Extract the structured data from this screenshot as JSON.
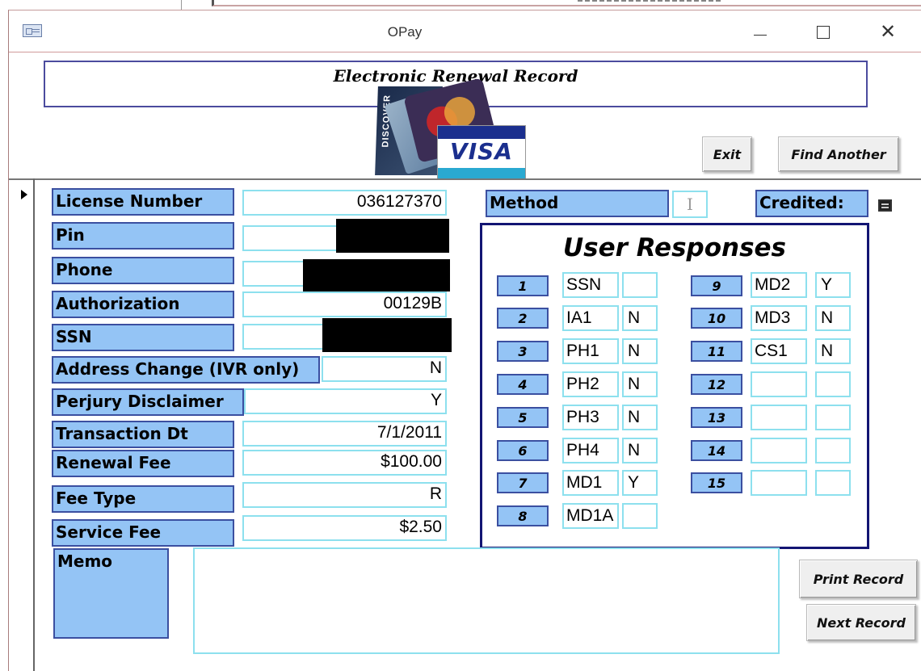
{
  "window": {
    "title": "OPay"
  },
  "header": {
    "title": "Electronic Renewal Record"
  },
  "cards": {
    "discover": "DISCOVER",
    "visa": "VISA"
  },
  "buttons": {
    "exit": "Exit",
    "find_another": "Find Another",
    "print_record": "Print Record",
    "next_record": "Next Record"
  },
  "fields": [
    {
      "label": "License Number",
      "value": "036127370",
      "redacted": false
    },
    {
      "label": "Pin",
      "value": "",
      "redacted": true
    },
    {
      "label": "Phone",
      "value": "",
      "redacted": true
    },
    {
      "label": "Authorization",
      "value": "00129B",
      "redacted": false
    },
    {
      "label": "SSN",
      "value": "",
      "redacted": true
    },
    {
      "label": "Address Change (IVR only)",
      "value": "N",
      "redacted": false
    },
    {
      "label": "Perjury Disclaimer",
      "value": "Y",
      "redacted": false
    },
    {
      "label": "Transaction Dt",
      "value": "7/1/2011",
      "redacted": false
    },
    {
      "label": "Renewal Fee",
      "value": "$100.00",
      "redacted": false
    },
    {
      "label": "Fee Type",
      "value": "R",
      "redacted": false
    },
    {
      "label": "Service Fee",
      "value": "$2.50",
      "redacted": false
    }
  ],
  "method": {
    "label": "Method",
    "value": "I"
  },
  "credited": {
    "label": "Credited:"
  },
  "user_responses": {
    "title": "User Responses",
    "items": [
      {
        "num": "1",
        "code": "SSN",
        "answer": ""
      },
      {
        "num": "2",
        "code": "IA1",
        "answer": "N"
      },
      {
        "num": "3",
        "code": "PH1",
        "answer": "N"
      },
      {
        "num": "4",
        "code": "PH2",
        "answer": "N"
      },
      {
        "num": "5",
        "code": "PH3",
        "answer": "N"
      },
      {
        "num": "6",
        "code": "PH4",
        "answer": "N"
      },
      {
        "num": "7",
        "code": "MD1",
        "answer": "Y"
      },
      {
        "num": "8",
        "code": "MD1A",
        "answer": ""
      },
      {
        "num": "9",
        "code": "MD2",
        "answer": "Y"
      },
      {
        "num": "10",
        "code": "MD3",
        "answer": "N"
      },
      {
        "num": "11",
        "code": "CS1",
        "answer": "N"
      },
      {
        "num": "12",
        "code": "",
        "answer": ""
      },
      {
        "num": "13",
        "code": "",
        "answer": ""
      },
      {
        "num": "14",
        "code": "",
        "answer": ""
      },
      {
        "num": "15",
        "code": "",
        "answer": ""
      }
    ]
  },
  "memo": {
    "label": "Memo",
    "value": ""
  },
  "colors": {
    "label_bg": "#94c4f5",
    "label_border": "#3b4fa0",
    "field_border": "#8de0ee",
    "panel_border": "#131573"
  }
}
